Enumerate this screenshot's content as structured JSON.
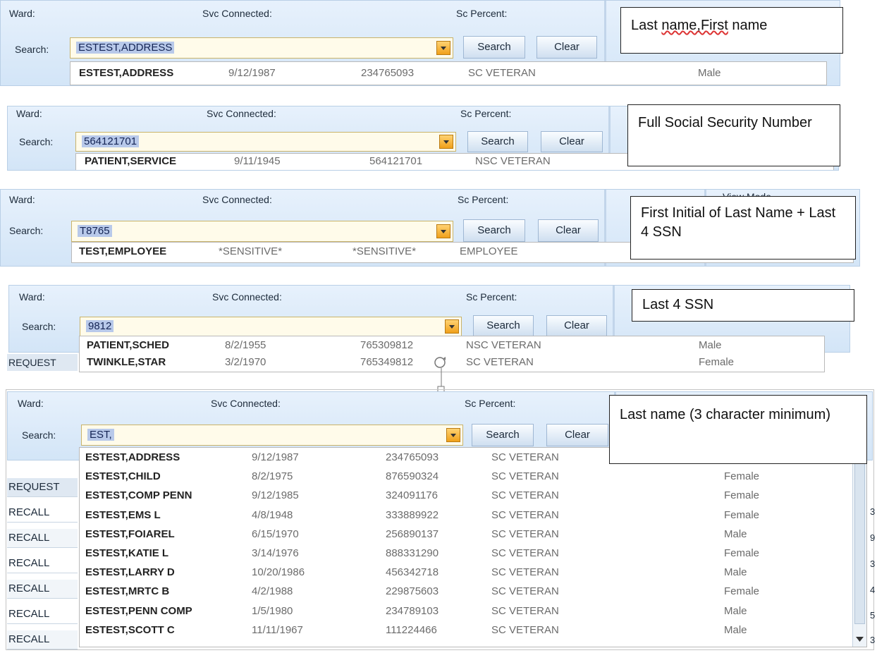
{
  "labels": {
    "ward": "Ward:",
    "svc": "Svc Connected:",
    "sc": "Sc Percent:",
    "search": "Search:",
    "search_btn": "Search",
    "clear_btn": "Clear"
  },
  "panel1": {
    "value": "ESTEST,ADDRESS",
    "callout": {
      "part1": "Last ",
      "part2": "name,First",
      "part3": " name"
    },
    "results": [
      {
        "name": "ESTEST,ADDRESS",
        "dob": "9/12/1987",
        "ssn": "234765093",
        "type": "SC VETERAN",
        "sex": "Male"
      }
    ]
  },
  "panel2": {
    "value": "564121701",
    "callout": "Full Social Security Number",
    "results": [
      {
        "name": "PATIENT,SERVICE",
        "dob": "9/11/1945",
        "ssn": "564121701",
        "type": "NSC VETERAN"
      }
    ]
  },
  "panel3": {
    "value": "T8765",
    "callout": "First Initial of Last Name + Last 4 SSN",
    "view_mode": "View Mode",
    "results": [
      {
        "name": "TEST,EMPLOYEE",
        "dob": "*SENSITIVE*",
        "ssn": "*SENSITIVE*",
        "type": "EMPLOYEE"
      }
    ]
  },
  "panel4": {
    "value": "9812",
    "callout": "Last 4 SSN",
    "grid_header": "REQUEST",
    "results": [
      {
        "name": "PATIENT,SCHED",
        "dob": "8/2/1955",
        "ssn": "765309812",
        "type": "NSC VETERAN",
        "sex": "Male"
      },
      {
        "name": "TWINKLE,STAR",
        "dob": "3/2/1970",
        "ssn": "765349812",
        "type": "SC VETERAN",
        "sex": "Female"
      }
    ]
  },
  "panel5": {
    "value": "EST,",
    "callout": "Last name (3 character minimum)",
    "grid": [
      "REQUEST",
      "RECALL",
      "RECALL",
      "RECALL",
      "RECALL",
      "RECALL",
      "RECALL",
      "RECALL"
    ],
    "right_edge_digits": [
      "3",
      "9",
      "3",
      "4",
      "5",
      "3"
    ],
    "results": [
      {
        "name": "ESTEST,ADDRESS",
        "dob": "9/12/1987",
        "ssn": "234765093",
        "type": "SC VETERAN",
        "sex": ""
      },
      {
        "name": "ESTEST,CHILD",
        "dob": "8/2/1975",
        "ssn": "876590324",
        "type": "SC VETERAN",
        "sex": "Female"
      },
      {
        "name": "ESTEST,COMP PENN",
        "dob": "9/12/1985",
        "ssn": "324091176",
        "type": "SC VETERAN",
        "sex": "Female"
      },
      {
        "name": "ESTEST,EMS L",
        "dob": "4/8/1948",
        "ssn": "333889922",
        "type": "SC VETERAN",
        "sex": "Female"
      },
      {
        "name": "ESTEST,FOIAREL",
        "dob": "6/15/1970",
        "ssn": "256890137",
        "type": "SC VETERAN",
        "sex": "Male"
      },
      {
        "name": "ESTEST,KATIE L",
        "dob": "3/14/1976",
        "ssn": "888331290",
        "type": "SC VETERAN",
        "sex": "Female"
      },
      {
        "name": "ESTEST,LARRY D",
        "dob": "10/20/1986",
        "ssn": "456342718",
        "type": "SC VETERAN",
        "sex": "Male"
      },
      {
        "name": "ESTEST,MRTC B",
        "dob": "4/2/1988",
        "ssn": "229875603",
        "type": "SC VETERAN",
        "sex": "Female"
      },
      {
        "name": "ESTEST,PENN COMP",
        "dob": "1/5/1980",
        "ssn": "234789103",
        "type": "SC VETERAN",
        "sex": "Male"
      },
      {
        "name": "ESTEST,SCOTT C",
        "dob": "11/11/1967",
        "ssn": "111224466",
        "type": "SC VETERAN",
        "sex": "Male"
      }
    ]
  }
}
